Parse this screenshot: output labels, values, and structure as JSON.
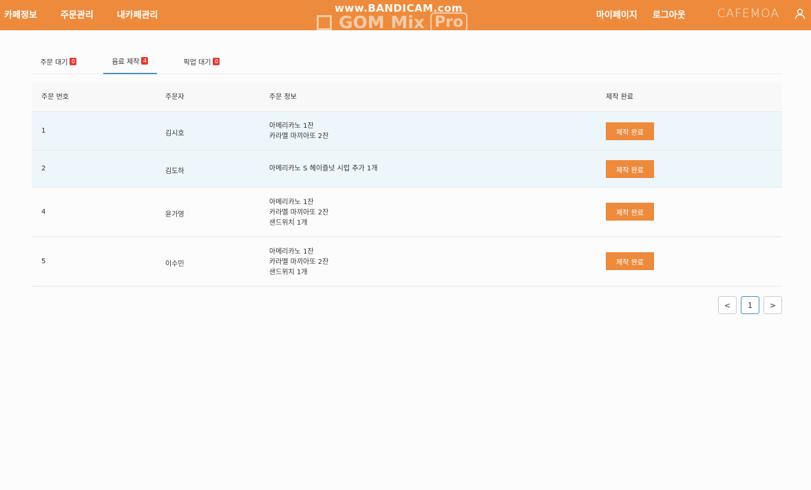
{
  "nav": {
    "left": [
      "카페정보",
      "주문관리",
      "내카페관리"
    ],
    "right": [
      "마이페이지",
      "로그아웃"
    ],
    "brand": "CAFEMOA"
  },
  "watermark": {
    "top": "www.BANDICAM.com",
    "bottom_main": "GOM Mix",
    "bottom_pro": "Pro"
  },
  "tabs": [
    {
      "label": "주문 대기",
      "count": "0",
      "active": false
    },
    {
      "label": "음료 제작",
      "count": "4",
      "active": true
    },
    {
      "label": "픽업 대기",
      "count": "0",
      "active": false
    }
  ],
  "table": {
    "headers": [
      "주문 번호",
      "주문자",
      "주문 정보",
      "제작 완료"
    ],
    "rows": [
      {
        "no": "1",
        "name": "김시호",
        "items": [
          "아메리카노 1잔",
          "카라멜 마끼아또 2잔"
        ],
        "action": "제작 완료"
      },
      {
        "no": "2",
        "name": "김도하",
        "items": [
          "아메리카노 S 헤이즐넛 시럽 추가 1개"
        ],
        "action": "제작 완료"
      },
      {
        "no": "4",
        "name": "윤가영",
        "items": [
          "아메리카노 1잔",
          "카라멜 마끼아또 2잔",
          "샌드위치 1개"
        ],
        "action": "제작 완료"
      },
      {
        "no": "5",
        "name": "이수민",
        "items": [
          "아메리카노 1잔",
          "카라멜 마끼아또 2잔",
          "샌드위치 1개"
        ],
        "action": "제작 완료"
      }
    ]
  },
  "pagination": {
    "prev": "<",
    "current": "1",
    "next": ">"
  },
  "colors": {
    "accent": "#ee8a3c",
    "badge": "#e53935",
    "active_tab": "#4a90c2",
    "row_highlight": "#edf6fb"
  }
}
